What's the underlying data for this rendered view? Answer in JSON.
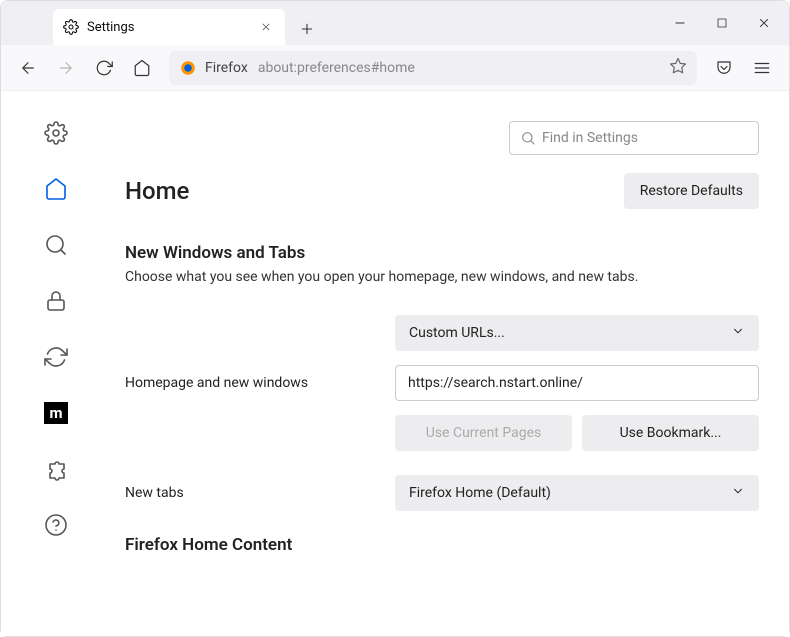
{
  "window": {
    "tab_title": "Settings"
  },
  "toolbar": {
    "browser_name": "Firefox",
    "url": "about:preferences#home"
  },
  "search": {
    "placeholder": "Find in Settings"
  },
  "page": {
    "title": "Home",
    "restore_btn": "Restore Defaults",
    "section1_heading": "New Windows and Tabs",
    "section1_desc": "Choose what you see when you open your homepage, new windows, and new tabs.",
    "homepage_label": "Homepage and new windows",
    "homepage_select": "Custom URLs...",
    "homepage_url": "https://search.nstart.online/",
    "use_current": "Use Current Pages",
    "use_bookmark": "Use Bookmark...",
    "newtabs_label": "New tabs",
    "newtabs_select": "Firefox Home (Default)",
    "section2_heading": "Firefox Home Content"
  }
}
